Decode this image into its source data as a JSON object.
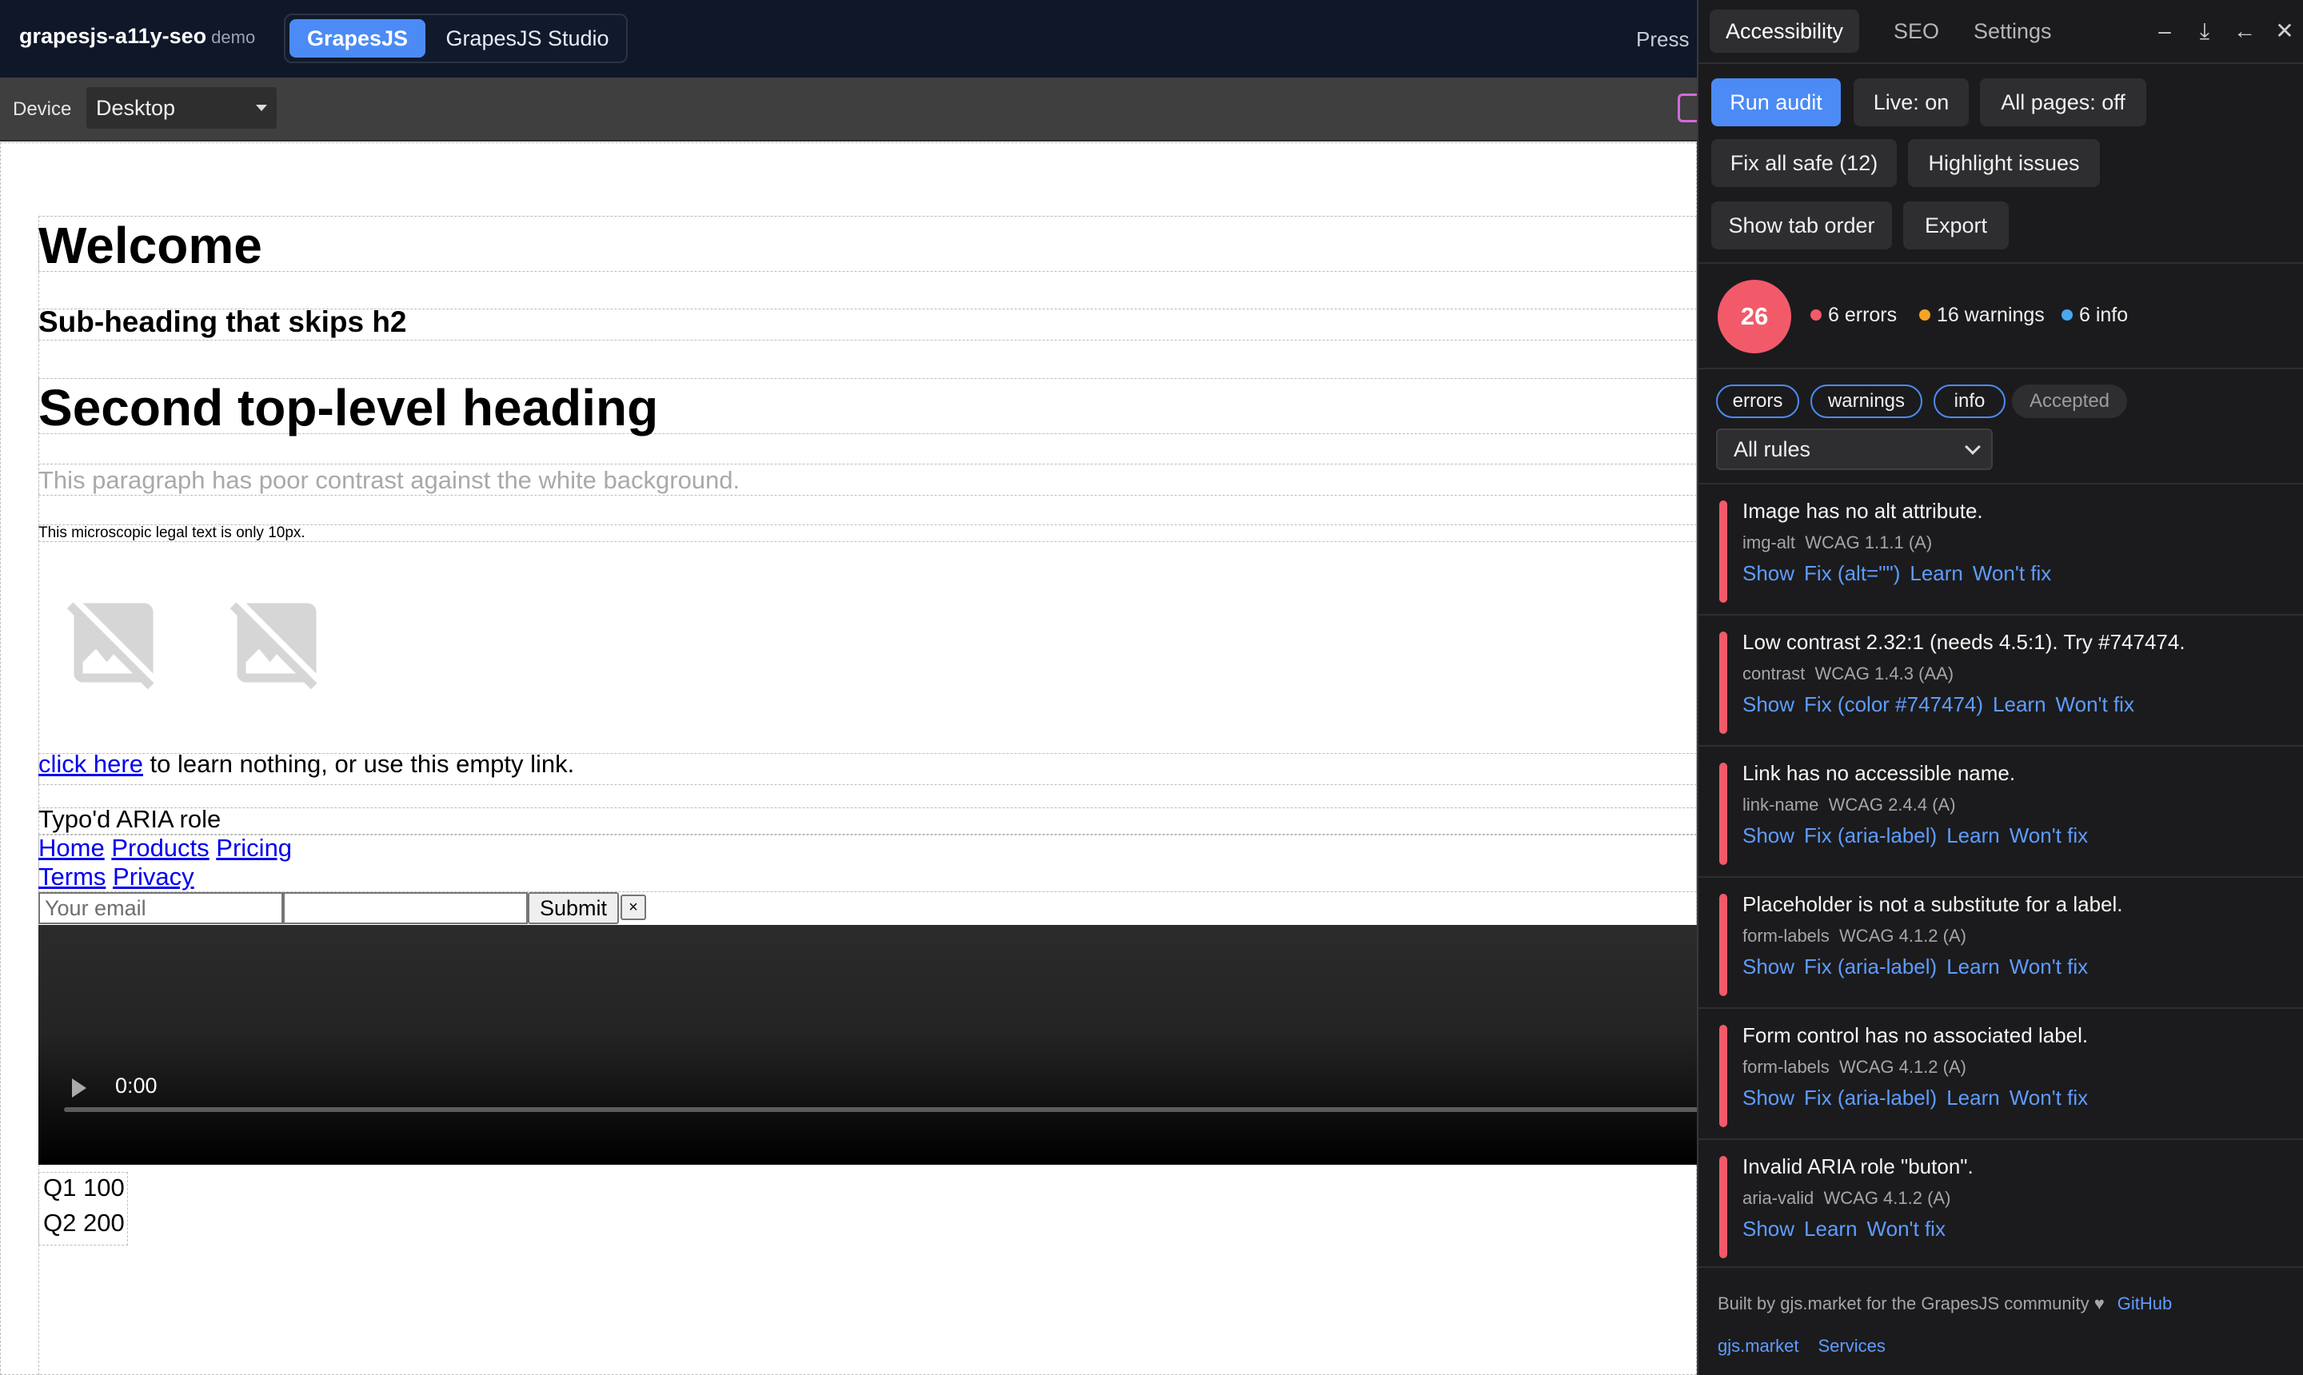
{
  "app": {
    "name": "grapesjs-a11y-seo",
    "badge": "demo",
    "toggle": [
      "GrapesJS",
      "GrapesJS Studio"
    ],
    "press_text": "Press"
  },
  "devicebar": {
    "label": "Device",
    "selected": "Desktop"
  },
  "canvas": {
    "heading1": "Welcome",
    "heading_skip": "Sub-heading that skips h2",
    "heading2": "Second top-level heading",
    "low_contrast_paragraph": "This paragraph has poor contrast against the white background.",
    "tiny_text": "This microscopic legal text is only 10px.",
    "link_click_here": "click here",
    "link_sentence_rest": " to learn nothing, or use this empty link.",
    "aria_typo": "Typo'd ARIA role",
    "nav1": [
      "Home",
      "Products",
      "Pricing"
    ],
    "nav2": [
      "Terms",
      "Privacy"
    ],
    "email_placeholder": "Your email",
    "submit_label": "Submit",
    "close_label": "×",
    "video_time": "0:00",
    "table_rows": [
      [
        "Q1",
        "100"
      ],
      [
        "Q2",
        "200"
      ]
    ]
  },
  "panel": {
    "tabs": [
      "Accessibility",
      "SEO",
      "Settings"
    ],
    "tools": [
      "–",
      "⤓",
      "←",
      "✕"
    ],
    "buttons": {
      "run_audit": "Run audit",
      "live": "Live: on",
      "all_pages": "All pages: off",
      "fix_all": "Fix all safe (12)",
      "highlight": "Highlight issues",
      "tab_order": "Show tab order",
      "export": "Export"
    },
    "score": "26",
    "stats": {
      "errors": "6 errors",
      "warnings": "16 warnings",
      "info": "6 info"
    },
    "filters": [
      "errors",
      "warnings",
      "info",
      "Accepted"
    ],
    "rule_select": "All rules",
    "issues": [
      {
        "title": "Image has no alt attribute.",
        "rule": "img-alt",
        "wcag": "WCAG 1.1.1 (A)",
        "actions": [
          "Show",
          "Fix (alt=\"\")",
          "Learn",
          "Won't fix"
        ]
      },
      {
        "title": "Low contrast 2.32:1 (needs 4.5:1). Try #747474.",
        "rule": "contrast",
        "wcag": "WCAG 1.4.3 (AA)",
        "actions": [
          "Show",
          "Fix (color #747474)",
          "Learn",
          "Won't fix"
        ]
      },
      {
        "title": "Link has no accessible name.",
        "rule": "link-name",
        "wcag": "WCAG 2.4.4 (A)",
        "actions": [
          "Show",
          "Fix (aria-label)",
          "Learn",
          "Won't fix"
        ]
      },
      {
        "title": "Placeholder is not a substitute for a label.",
        "rule": "form-labels",
        "wcag": "WCAG 4.1.2 (A)",
        "actions": [
          "Show",
          "Fix (aria-label)",
          "Learn",
          "Won't fix"
        ]
      },
      {
        "title": "Form control has no associated label.",
        "rule": "form-labels",
        "wcag": "WCAG 4.1.2 (A)",
        "actions": [
          "Show",
          "Fix (aria-label)",
          "Learn",
          "Won't fix"
        ]
      },
      {
        "title": "Invalid ARIA role \"buton\".",
        "rule": "aria-valid",
        "wcag": "WCAG 4.1.2 (A)",
        "actions": [
          "Show",
          "Learn",
          "Won't fix"
        ]
      }
    ],
    "footer": {
      "text": "Built by gjs.market for the GrapesJS community ♥",
      "github": "GitHub",
      "market": "gjs.market",
      "services": "Services"
    }
  },
  "colors": {
    "accent": "#4c8bf5",
    "error": "#f25a6a",
    "warning": "#f5a524",
    "info": "#4aa8f0",
    "link": "#5f9cff"
  }
}
